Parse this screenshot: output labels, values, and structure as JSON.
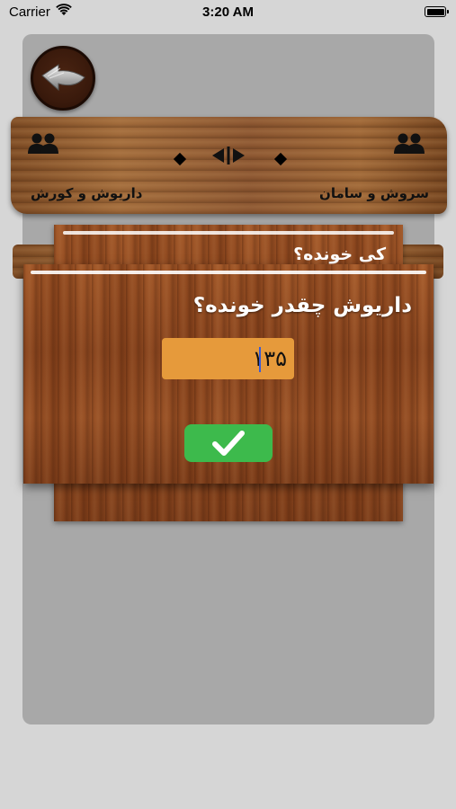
{
  "status_bar": {
    "carrier": "Carrier",
    "time": "3:20 AM",
    "battery_level": 1.0
  },
  "header": {
    "back_icon": "back-arrow-icon"
  },
  "teams": {
    "left_team": "داریوش و کورش",
    "right_team": "سروش و سامان",
    "left_icon": "people-icon",
    "right_icon": "people-icon",
    "swap_icon": "swap-arrows-icon"
  },
  "background_card": {
    "question": "کی خونده؟"
  },
  "dialog": {
    "title": "داریوش چقدر خونده؟",
    "score_value": "۱۳۵",
    "confirm_icon": "checkmark-icon"
  },
  "colors": {
    "input_background": "#e69a3b",
    "confirm_button": "#3dba4c",
    "caret": "#3a5bd6"
  }
}
